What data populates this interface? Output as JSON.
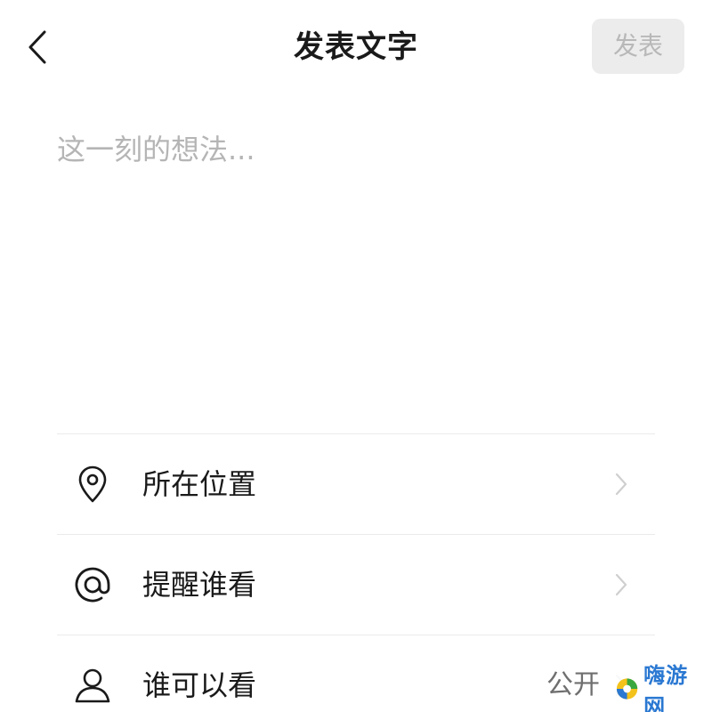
{
  "header": {
    "title": "发表文字",
    "publish_label": "发表",
    "back_icon": "chevron-left-icon"
  },
  "composer": {
    "placeholder": "这一刻的想法...",
    "value": ""
  },
  "options": [
    {
      "icon": "location-pin-icon",
      "label": "所在位置",
      "value": ""
    },
    {
      "icon": "at-sign-icon",
      "label": "提醒谁看",
      "value": ""
    },
    {
      "icon": "person-icon",
      "label": "谁可以看",
      "value": "公开"
    }
  ],
  "watermark": {
    "text": "嗨游网"
  },
  "colors": {
    "publish_bg": "#ececec",
    "publish_text": "#b8b8b8",
    "placeholder": "#b5b5b5",
    "divider": "#ebebeb",
    "watermark_blue": "#2a78d2"
  }
}
